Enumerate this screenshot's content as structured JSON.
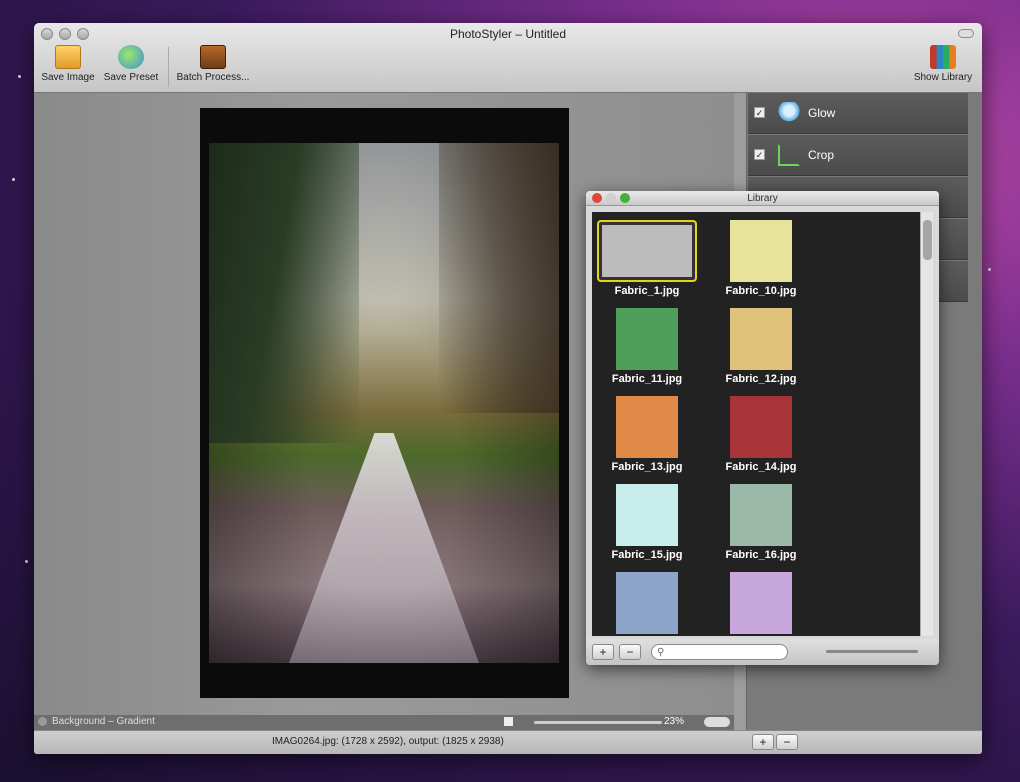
{
  "window": {
    "title": "PhotoStyler – Untitled"
  },
  "toolbar": {
    "save_image": "Save Image",
    "save_preset": "Save Preset",
    "batch_process": "Batch Process...",
    "show_library": "Show Library"
  },
  "effects": [
    {
      "label": "Glow",
      "checked": true,
      "icon": "lightbulb-icon"
    },
    {
      "label": "Crop",
      "checked": true,
      "icon": "crop-icon"
    }
  ],
  "status": {
    "layer": "Background – Gradient",
    "zoom": "23%",
    "file_info": "IMAG0264.jpg: (1728 x 2592), output: (1825 x 2938)"
  },
  "bottom_buttons": {
    "add": "+",
    "remove": "−"
  },
  "library": {
    "title": "Library",
    "items": [
      {
        "name": "Fabric_1.jpg",
        "color": "#bcbcbc",
        "selected": true
      },
      {
        "name": "Fabric_10.jpg",
        "color": "#e8e39a"
      },
      {
        "name": "Fabric_11.jpg",
        "color": "#4f9e5a"
      },
      {
        "name": "Fabric_12.jpg",
        "color": "#e0c27a"
      },
      {
        "name": "Fabric_13.jpg",
        "color": "#e08a4a"
      },
      {
        "name": "Fabric_14.jpg",
        "color": "#a8343a"
      },
      {
        "name": "Fabric_15.jpg",
        "color": "#c9ecec"
      },
      {
        "name": "Fabric_16.jpg",
        "color": "#9ab9a8"
      },
      {
        "name": "",
        "color": "#8da5c9"
      },
      {
        "name": "",
        "color": "#c7a7dc"
      }
    ],
    "add": "+",
    "remove": "−"
  }
}
